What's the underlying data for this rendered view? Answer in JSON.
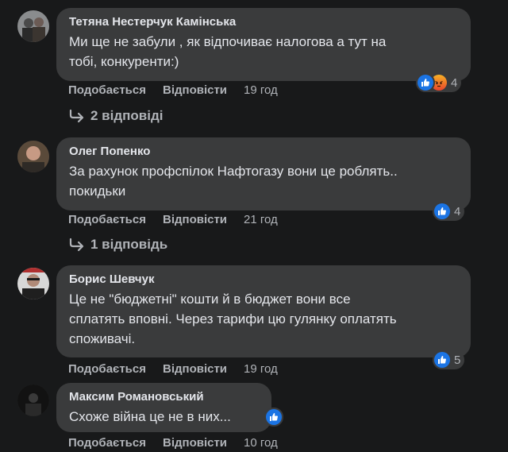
{
  "actions": {
    "like_label": "Подобається",
    "reply_label": "Відповісти"
  },
  "comments": [
    {
      "author": "Тетяна Нестерчук Камінська",
      "lines": [
        "Ми ще не забули , як відпочиває налогова а тут на",
        "тобі, конкуренти:)"
      ],
      "time": "19 год",
      "reactions": [
        "like-icon",
        "angry-icon"
      ],
      "reaction_count": "4",
      "replies": "2 відповіді"
    },
    {
      "author": "Олег Попенко",
      "lines": [
        "За рахунок профспілок Нафтогазу вони це роблять..",
        "покидьки"
      ],
      "time": "21 год",
      "reactions": [
        "like-icon"
      ],
      "reaction_count": "4",
      "replies": "1 відповідь"
    },
    {
      "author": "Борис Шевчук",
      "lines": [
        "Це не \"бюджетні\" кошти й в бюджет вони все",
        "сплатять вповні. Через тарифи цю гулянку оплатять",
        "споживачі."
      ],
      "time": "19 год",
      "reactions": [
        "like-icon"
      ],
      "reaction_count": "5"
    },
    {
      "author": "Максим Романовський",
      "lines": [
        "Схоже війна це не в них..."
      ],
      "time": "10 год",
      "reactions": [
        "like-icon"
      ],
      "reaction_count": ""
    }
  ],
  "colors": {
    "background": "#18191a",
    "bubble": "#3a3b3c",
    "like_blue": "#1b74e4",
    "secondary_text": "#b0b3b8"
  }
}
